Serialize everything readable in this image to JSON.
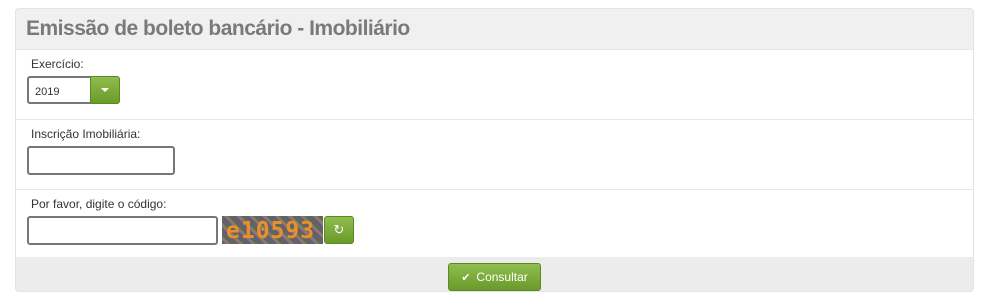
{
  "panel": {
    "title": "Emissão de boleto bancário - Imobiliário"
  },
  "exercicio": {
    "label": "Exercício:",
    "selected": "2019"
  },
  "inscricao": {
    "label": "Inscrição Imobiliária:",
    "value": ""
  },
  "captcha": {
    "label": "Por favor, digite o código:",
    "value": "",
    "code": "e10593"
  },
  "actions": {
    "refresh_icon": "↻",
    "submit_icon": "✔",
    "submit_label": "Consultar"
  }
}
